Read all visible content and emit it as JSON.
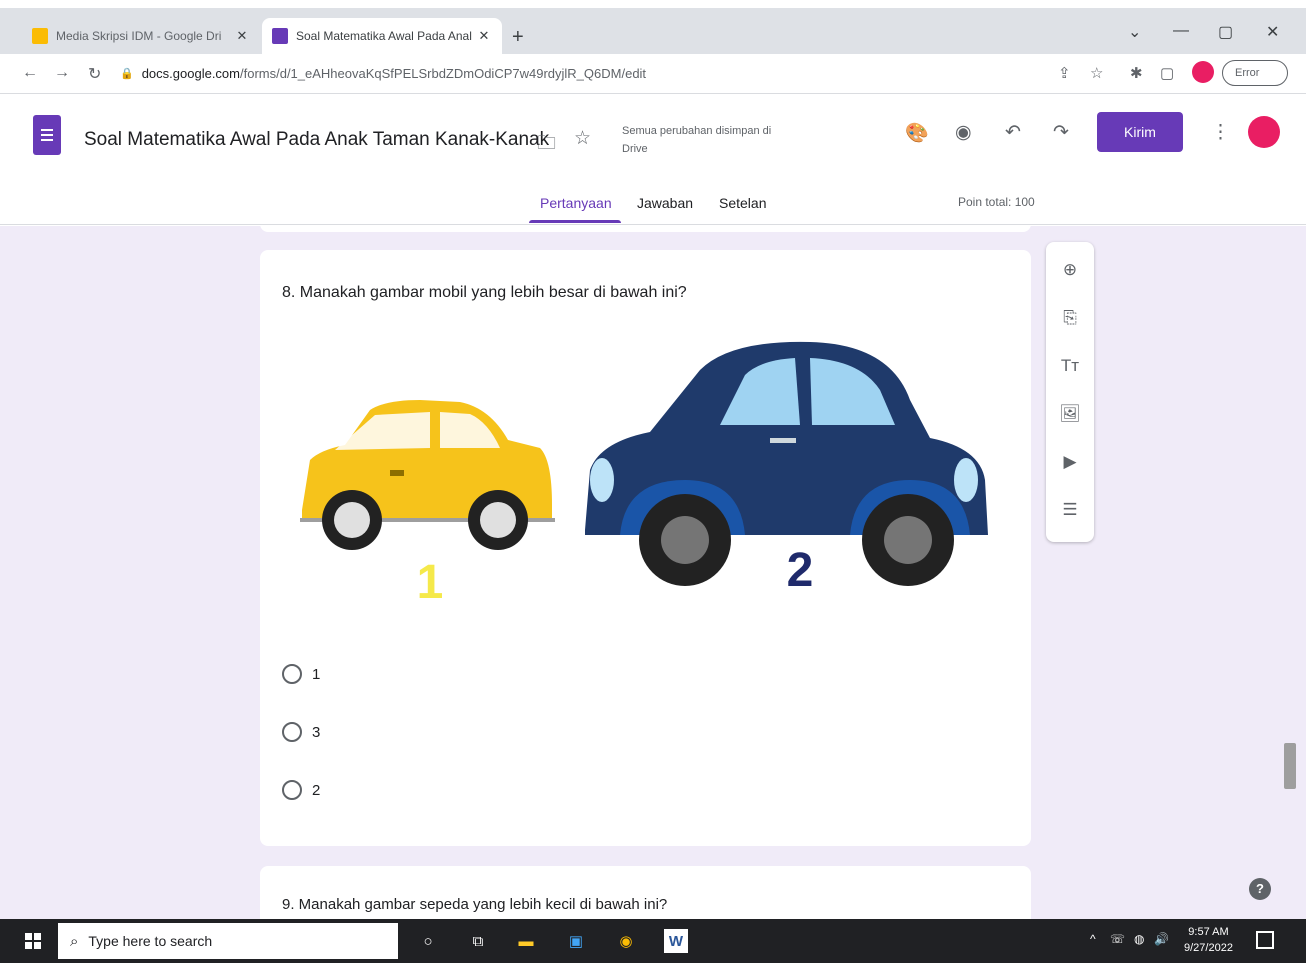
{
  "browser": {
    "tabs": [
      {
        "title": "Media Skripsi IDM - Google Dri",
        "close": "✕",
        "icon_color": "#fbbc04"
      },
      {
        "title": "Soal Matematika Awal Pada Anal",
        "close": "✕",
        "icon_color": "#673ab7"
      }
    ],
    "new_tab": "+",
    "window_controls": {
      "chevron": "⌄",
      "minimize": "—",
      "maximize": "▢",
      "close": "✕"
    },
    "nav": {
      "back": "←",
      "forward": "→",
      "reload": "↻"
    },
    "address": {
      "lock": "🔒",
      "host": "docs.google.com",
      "path": "/forms/d/1_eAHheovaKqSfPELSrbdZDmOdiCP7w49rdyjlR_Q6DM/edit"
    },
    "right_icons": {
      "share": "⇪",
      "bookmark": "☆",
      "extensions": "✱",
      "sidebar": "▢"
    },
    "error_label": "Error"
  },
  "form": {
    "title": "Soal Matematika Awal Pada Anak Taman Kanak-Kanak",
    "save_status": "Semua perubahan disimpan di Drive",
    "send_label": "Kirim",
    "more_icon": "⋮",
    "header_icons": {
      "palette": "🎨",
      "preview": "◉",
      "undo": "↶",
      "redo": "↷",
      "folder": "🗀",
      "star": "☆"
    },
    "tabs": {
      "questions": "Pertanyaan",
      "responses": "Jawaban",
      "settings": "Setelan"
    },
    "total_points": "Poin total: 100",
    "accent": "#673ab7",
    "question": {
      "text": "8.  Manakah gambar mobil yang lebih besar di bawah ini?",
      "image_labels": {
        "car1": "1",
        "car2": "2"
      },
      "options": [
        "1",
        "3",
        "2"
      ]
    },
    "next_question": "9. Manakah gambar sepeda yang lebih kecil di bawah ini?",
    "toolbar_icons": {
      "add": "⊕",
      "import": "⎘",
      "title": "Tт",
      "image": "🖼",
      "video": "▶",
      "section": "☰"
    },
    "help": "?"
  },
  "taskbar": {
    "search_placeholder": "Type here to search",
    "search_icon": "⌕",
    "icons": {
      "cortana": "○",
      "taskview": "⧉",
      "explorer": "▬",
      "media": "▣",
      "chrome": "◉",
      "word": "W"
    },
    "tray": {
      "chevron": "^",
      "network": "☏",
      "wifi": "◍",
      "volume": "🔊"
    },
    "time": "9:57 AM",
    "date": "9/27/2022"
  }
}
